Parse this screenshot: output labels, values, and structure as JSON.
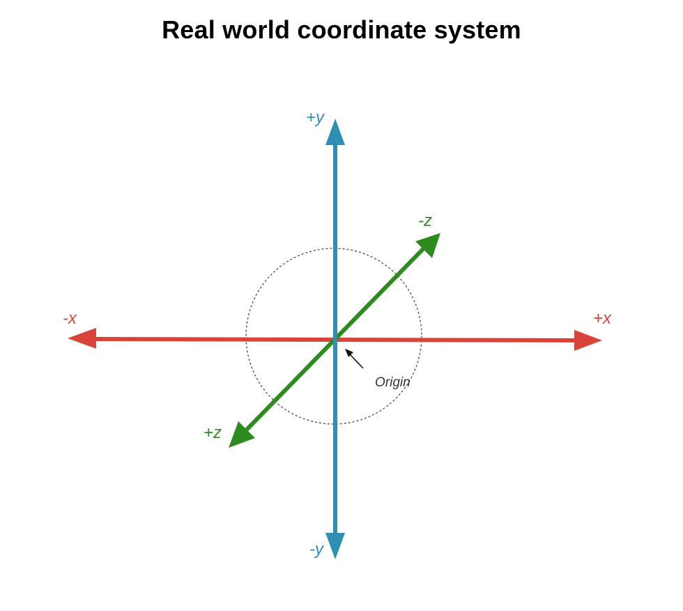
{
  "title": "Real world coordinate system",
  "axes": {
    "x_positive": "+x",
    "x_negative": "-x",
    "y_positive": "+y",
    "y_negative": "-y",
    "z_positive": "+z",
    "z_negative": "-z"
  },
  "origin_label": "Origin",
  "colors": {
    "x_axis": "#d9443a",
    "y_axis": "#2f8fb3",
    "z_axis": "#2e8b1f",
    "circle": "#555555",
    "origin_arrow": "#111111",
    "origin_text": "#333333"
  }
}
